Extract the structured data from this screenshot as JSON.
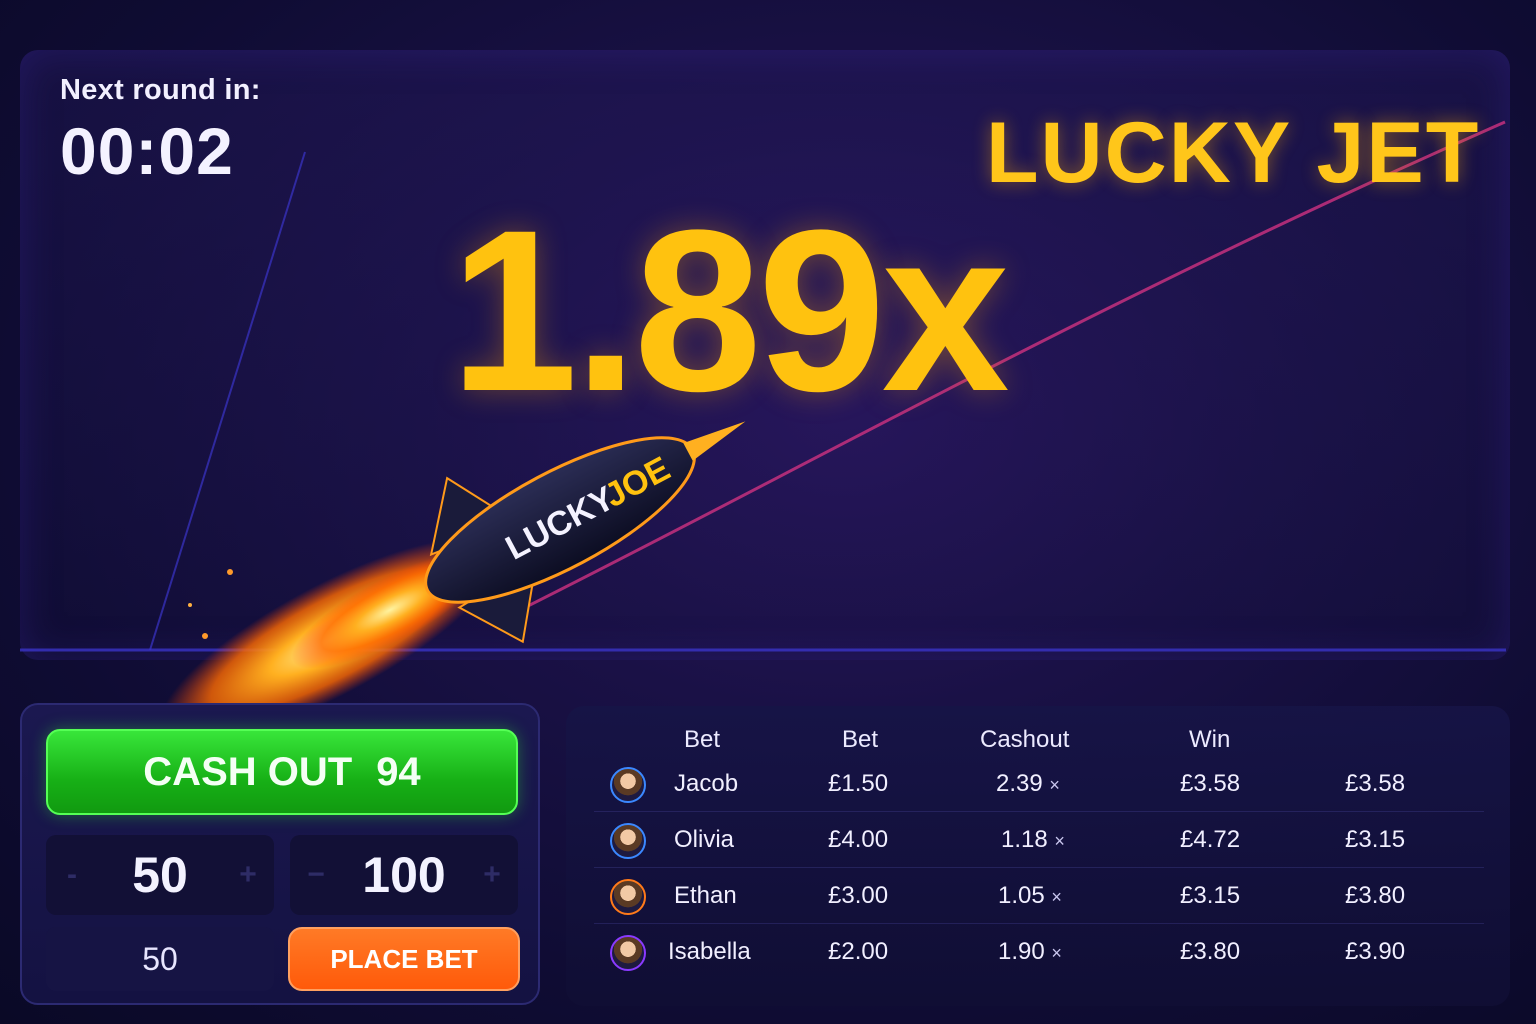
{
  "countdown": {
    "label": "Next round in:",
    "value": "00:02"
  },
  "brand": {
    "title": "LUCKY JET",
    "rocket_label_left": "LUCKY",
    "rocket_label_right": "JOE"
  },
  "game": {
    "multiplier": "1.89x"
  },
  "bet_panel": {
    "cashout_label": "CASH OUT",
    "cashout_value": "94",
    "stepper_left": {
      "minus": "-",
      "value": "50",
      "plus": "+"
    },
    "stepper_right": {
      "minus": "−",
      "value": "100",
      "plus": "+"
    },
    "amount_value": "50",
    "place_bet_label": "PLACE BET"
  },
  "table": {
    "headers": [
      "Bet",
      "Bet",
      "Cashout",
      "Win"
    ],
    "rows": [
      {
        "name": "Jacob",
        "bet": "£1.50",
        "cashout": "2.39",
        "mult": "×",
        "win": "£3.58",
        "extra": "£3.58"
      },
      {
        "name": "Olivia",
        "bet": "£4.00",
        "cashout": "1.18",
        "mult": "×",
        "win": "£4.72",
        "extra": "£3.15"
      },
      {
        "name": "Ethan",
        "bet": "£3.00",
        "cashout": "1.05",
        "mult": "×",
        "win": "£3.15",
        "extra": "£3.80"
      },
      {
        "name": "Isabella",
        "bet": "£2.00",
        "cashout": "1.90",
        "mult": "×",
        "win": "£3.80",
        "extra": "£3.90"
      }
    ]
  },
  "colors": {
    "accent_yellow": "#ffc20f",
    "cashout_green": "#17b016",
    "place_bet_orange": "#ff5a0a",
    "background": "#0b0a2a",
    "trail_pink": "#c4307e"
  }
}
